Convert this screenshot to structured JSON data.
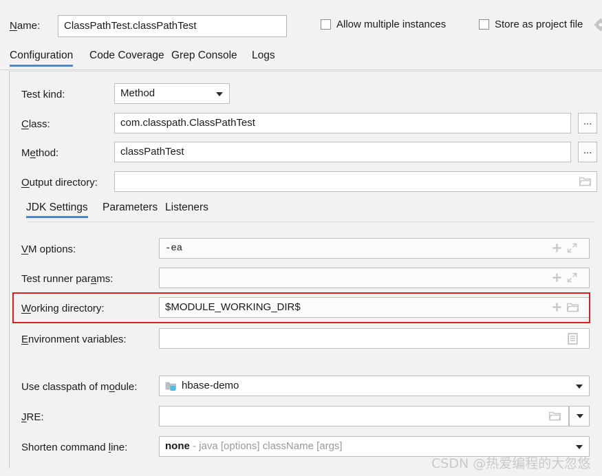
{
  "window": {
    "name_label": "Name:",
    "name_value": "ClassPathTest.classPathTest",
    "allow_multiple_instances_label": "Allow multiple instances",
    "allow_multiple_instances_checked": false,
    "store_as_project_file_label": "Store as project file",
    "store_as_project_file_checked": false,
    "gear_icon": "gear-icon"
  },
  "outer_tabs": [
    {
      "label": "Configuration",
      "active": true
    },
    {
      "label": "Code Coverage",
      "active": false
    },
    {
      "label": "Grep Console",
      "active": false
    },
    {
      "label": "Logs",
      "active": false
    }
  ],
  "configuration": {
    "test_kind": {
      "label": "Test kind:",
      "value": "Method",
      "icon": "chevron-down-icon"
    },
    "class": {
      "label": "Class:",
      "value": "com.classpath.ClassPathTest",
      "browse_label": "..."
    },
    "method": {
      "label": "Method:",
      "value": "classPathTest",
      "browse_label": "..."
    },
    "output_directory": {
      "label": "Output directory:",
      "value": "",
      "icon": "folder-icon"
    }
  },
  "inner_tabs": [
    {
      "label": "JDK Settings",
      "active": true
    },
    {
      "label": "Parameters",
      "active": false
    },
    {
      "label": "Listeners",
      "active": false
    }
  ],
  "jdk_settings": {
    "vm_options": {
      "label": "VM options:",
      "value": "-ea",
      "icons": [
        "plus-icon",
        "expand-icon"
      ]
    },
    "test_runner_params": {
      "label": "Test runner params:",
      "value": "",
      "icons": [
        "plus-icon",
        "expand-icon"
      ]
    },
    "working_directory": {
      "label": "Working directory:",
      "value": "$MODULE_WORKING_DIR$",
      "icons": [
        "plus-icon",
        "folder-icon"
      ],
      "highlighted": true,
      "highlight_color": "#e01b1b"
    },
    "environment_variables": {
      "label": "Environment variables:",
      "value": "",
      "icons": [
        "list-document-icon"
      ]
    },
    "use_classpath_of_module": {
      "label": "Use classpath of module:",
      "value": "hbase-demo",
      "item_icon": "module-icon",
      "icon": "chevron-down-icon"
    },
    "jre": {
      "label": "JRE:",
      "value": "",
      "icons": [
        "folder-icon",
        "chevron-down-icon"
      ]
    },
    "shorten_command_line": {
      "label": "Shorten command line:",
      "value_strong": "none",
      "value_hint": "- java [options] className [args]",
      "icon": "chevron-down-icon"
    }
  },
  "watermark": {
    "text": "CSDN @热爱编程的大忽悠"
  },
  "colors": {
    "accent_blue": "#4a88c8",
    "highlight_red": "#e01b1b",
    "background": "#f2f2f2",
    "field_background": "#ffffff"
  }
}
